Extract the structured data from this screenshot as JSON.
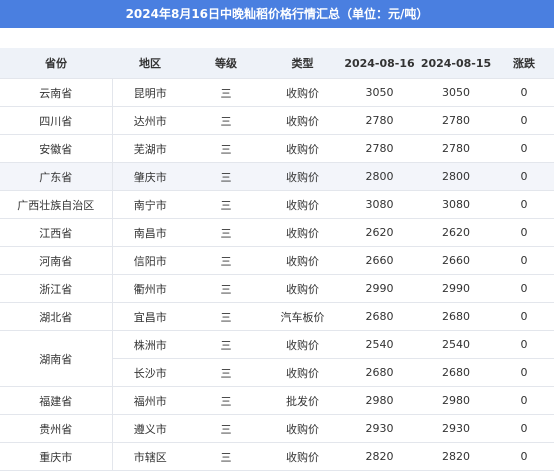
{
  "title": "2024年8月16日中晚籼稻价格行情汇总（单位：元/吨）",
  "headers": [
    "省份",
    "地区",
    "等级",
    "类型",
    "2024-08-16",
    "2024-08-15",
    "涨跌"
  ],
  "rows": [
    {
      "province": "云南省",
      "region": "昆明市",
      "grade": "三",
      "type": "收购价",
      "d16": "3050",
      "d15": "3050",
      "change": "0"
    },
    {
      "province": "四川省",
      "region": "达州市",
      "grade": "三",
      "type": "收购价",
      "d16": "2780",
      "d15": "2780",
      "change": "0"
    },
    {
      "province": "安徽省",
      "region": "芜湖市",
      "grade": "三",
      "type": "收购价",
      "d16": "2780",
      "d15": "2780",
      "change": "0"
    },
    {
      "province": "广东省",
      "region": "肇庆市",
      "grade": "三",
      "type": "收购价",
      "d16": "2800",
      "d15": "2800",
      "change": "0"
    },
    {
      "province": "广西壮族自治区",
      "region": "南宁市",
      "grade": "三",
      "type": "收购价",
      "d16": "3080",
      "d15": "3080",
      "change": "0"
    },
    {
      "province": "江西省",
      "region": "南昌市",
      "grade": "三",
      "type": "收购价",
      "d16": "2620",
      "d15": "2620",
      "change": "0"
    },
    {
      "province": "河南省",
      "region": "信阳市",
      "grade": "三",
      "type": "收购价",
      "d16": "2660",
      "d15": "2660",
      "change": "0"
    },
    {
      "province": "浙江省",
      "region": "衢州市",
      "grade": "三",
      "type": "收购价",
      "d16": "2990",
      "d15": "2990",
      "change": "0"
    },
    {
      "province": "湖北省",
      "region": "宜昌市",
      "grade": "三",
      "type": "汽车板价",
      "d16": "2680",
      "d15": "2680",
      "change": "0"
    },
    {
      "province": "湖南省",
      "region": "株洲市",
      "grade": "三",
      "type": "收购价",
      "d16": "2540",
      "d15": "2540",
      "change": "0"
    },
    {
      "province": "",
      "region": "长沙市",
      "grade": "三",
      "type": "收购价",
      "d16": "2680",
      "d15": "2680",
      "change": "0"
    },
    {
      "province": "福建省",
      "region": "福州市",
      "grade": "三",
      "type": "批发价",
      "d16": "2980",
      "d15": "2980",
      "change": "0"
    },
    {
      "province": "贵州省",
      "region": "遵义市",
      "grade": "三",
      "type": "收购价",
      "d16": "2930",
      "d15": "2930",
      "change": "0"
    },
    {
      "province": "重庆市",
      "region": "市辖区",
      "grade": "三",
      "type": "收购价",
      "d16": "2820",
      "d15": "2820",
      "change": "0"
    }
  ]
}
